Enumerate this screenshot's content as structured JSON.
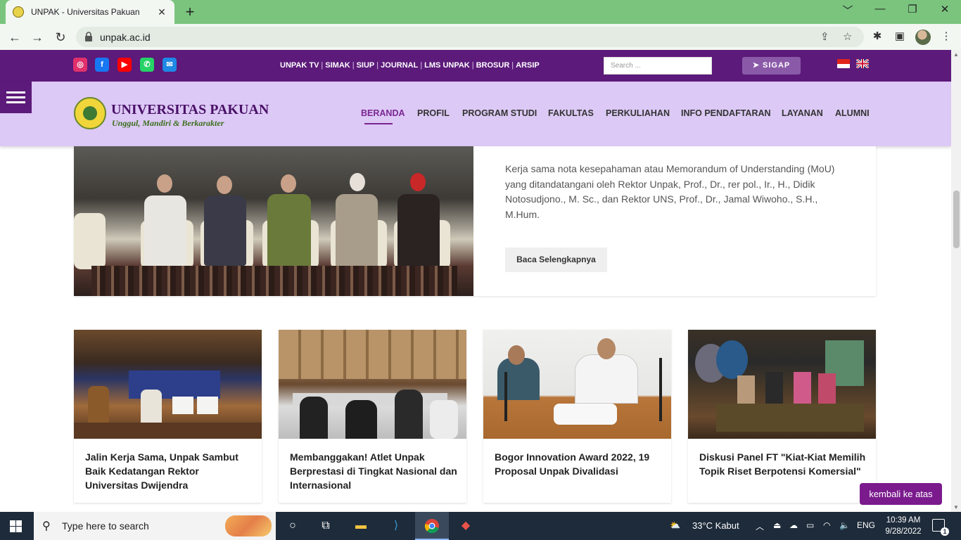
{
  "browser": {
    "tab_title": "UNPAK - Universitas Pakuan",
    "tab_close": "✕",
    "new_tab": "+",
    "url": "unpak.ac.id",
    "window_controls": [
      "﹀",
      "—",
      "❐",
      "✕"
    ]
  },
  "site": {
    "socials": [
      {
        "name": "instagram-icon",
        "color": "#e1306c"
      },
      {
        "name": "facebook-icon",
        "color": "#1877f2"
      },
      {
        "name": "youtube-icon",
        "color": "#ff0000"
      },
      {
        "name": "whatsapp-icon",
        "color": "#25d366"
      },
      {
        "name": "email-icon",
        "color": "#1e88e5"
      }
    ],
    "top_links": [
      "UNPAK TV",
      "SIMAK",
      "SIUP",
      "JOURNAL",
      "LMS UNPAK",
      "BROSUR",
      "ARSIP"
    ],
    "search_placeholder": "Search ...",
    "sigap_label": "SIGAP",
    "brand": "UNIVERSITAS PAKUAN",
    "tagline": "Unggul, Mandiri & Berkarakter",
    "menu": [
      "BERANDA",
      "PROFIL",
      "PROGRAM STUDI",
      "FAKULTAS",
      "PERKULIAHAN",
      "INFO PENDAFTARAN",
      "LAYANAN",
      "ALUMNI"
    ],
    "active_menu": "BERANDA",
    "colors": {
      "topbar": "#5c1a7a",
      "nav": "#dcc9f5",
      "accent": "#7a2593"
    }
  },
  "featured": {
    "excerpt": "Kerja sama nota kesepahaman atau Memorandum of Understanding (MoU) yang ditandatangani oleh Rektor Unpak, Prof., Dr., rer pol., Ir., H., Didik Notosudjono., M. Sc., dan Rektor UNS, Prof., Dr., Jamal Wiwoho., S.H., M.Hum.",
    "read_more": "Baca Selengkapnya"
  },
  "news": [
    {
      "title": "Jalin Kerja Sama, Unpak Sambut Baik Kedatangan Rektor Universitas Dwijendra"
    },
    {
      "title": "Membanggakan! Atlet Unpak Berprestasi di Tingkat Nasional dan Internasional"
    },
    {
      "title": "Bogor Innovation Award 2022, 19 Proposal Unpak Divalidasi"
    },
    {
      "title": "Diskusi Panel FT \"Kiat-Kiat Memilih Topik Riset Berpotensi Komersial\""
    }
  ],
  "back_to_top": "kembali ke atas",
  "taskbar": {
    "search_text": "Type here to search",
    "weather": "33°C  Kabut",
    "language": "ENG",
    "time": "10:39 AM",
    "date": "9/28/2022",
    "notifications": "1"
  }
}
